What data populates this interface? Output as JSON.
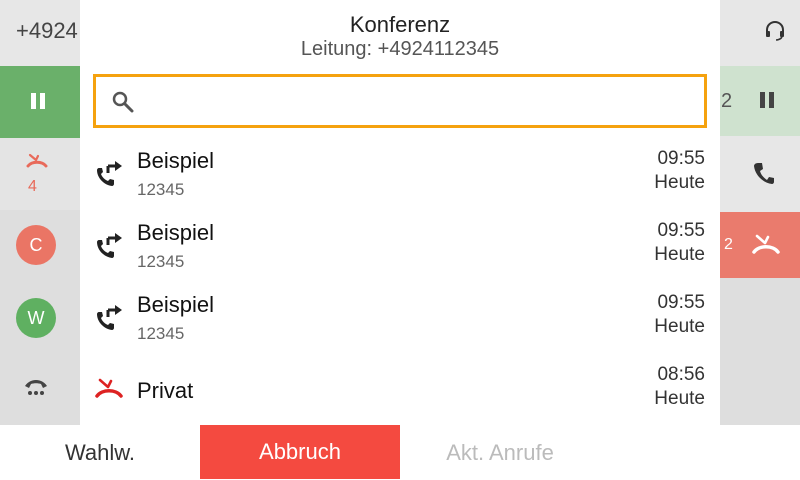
{
  "left": {
    "top_number": "+4924",
    "missed_count": "4",
    "avatars": [
      "C",
      "W"
    ]
  },
  "right": {
    "hold_number": "2",
    "red_number": "2"
  },
  "dialog": {
    "title": "Konferenz",
    "subtitle": "Leitung: +4924112345",
    "search": {
      "value": "",
      "placeholder": ""
    },
    "items": [
      {
        "name": "Beispiel",
        "number": "12345",
        "time": "09:55",
        "day": "Heute",
        "icon": "forwarded-call-icon"
      },
      {
        "name": "Beispiel",
        "number": "12345",
        "time": "09:55",
        "day": "Heute",
        "icon": "forwarded-call-icon"
      },
      {
        "name": "Beispiel",
        "number": "12345",
        "time": "09:55",
        "day": "Heute",
        "icon": "forwarded-call-icon"
      },
      {
        "name": "Privat",
        "number": "",
        "time": "08:56",
        "day": "Heute",
        "icon": "missed-call-icon"
      }
    ]
  },
  "softkeys": {
    "dial": "Wahlw.",
    "cancel": "Abbruch",
    "active_calls": "Akt. Anrufe",
    "fourth": ""
  },
  "colors": {
    "accent_search": "#f5a20e",
    "cancel_red": "#f44a40",
    "hold_green": "#6ab06a",
    "missed_red": "#e86a5a"
  }
}
